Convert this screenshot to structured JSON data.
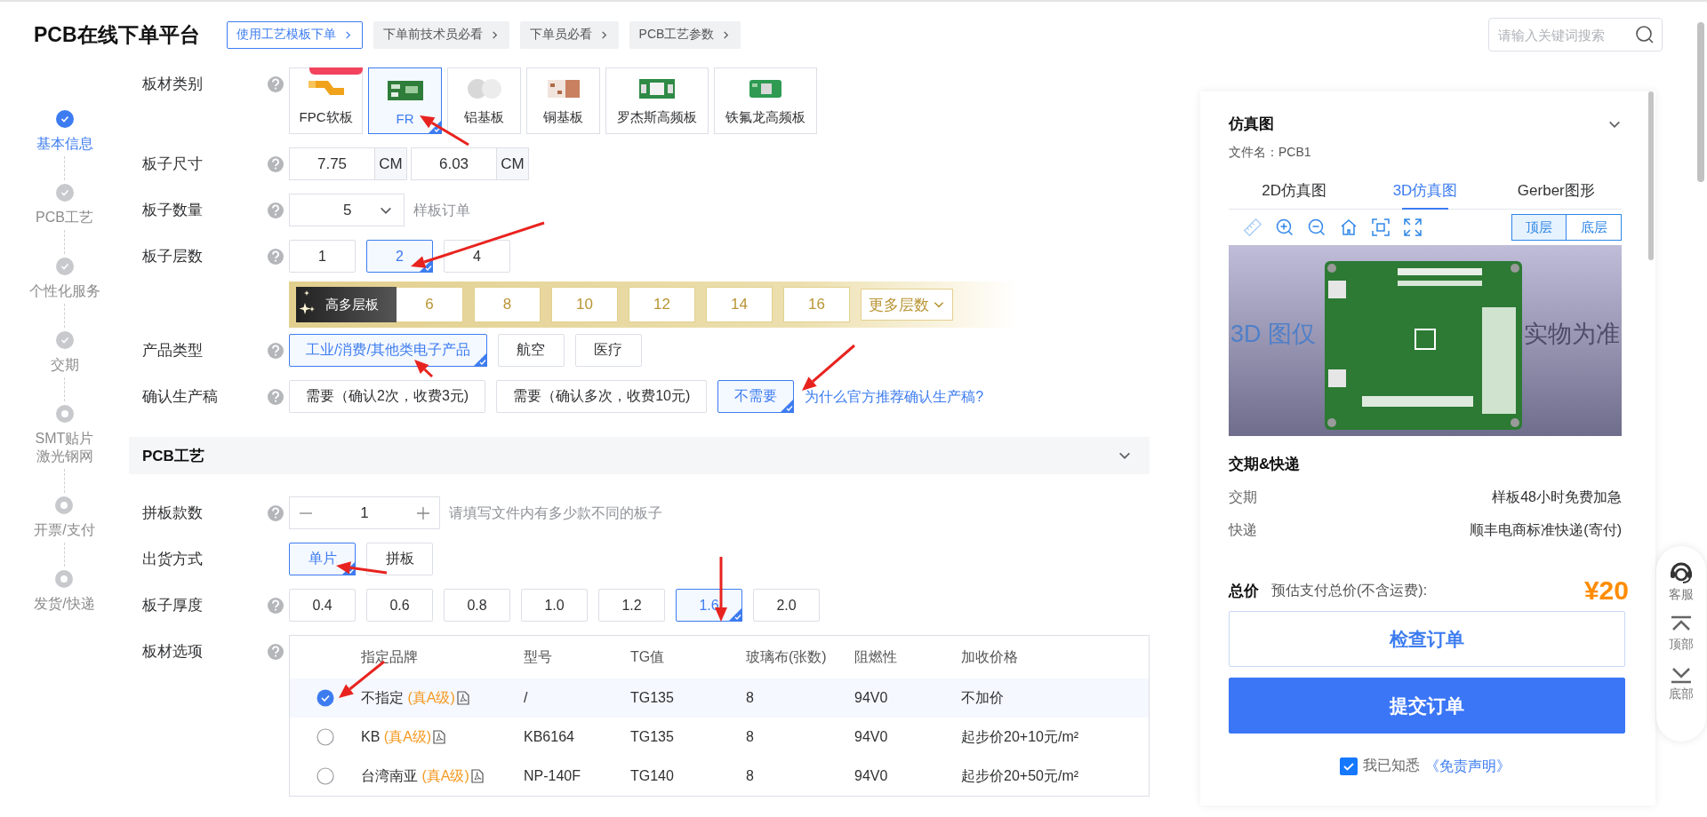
{
  "header": {
    "title": "PCB在线下单平台",
    "links": [
      {
        "label": "使用工艺模板下单",
        "kind": "primary"
      },
      {
        "label": "下单前技术员必看",
        "kind": "plain"
      },
      {
        "label": "下单员必看",
        "kind": "plain"
      },
      {
        "label": "PCB工艺参数",
        "kind": "plain"
      }
    ],
    "search": {
      "placeholder": "请输入关键词搜索"
    }
  },
  "steps": [
    {
      "label": "基本信息",
      "selected": true,
      "done": true
    },
    {
      "label": "PCB工艺",
      "selected": false,
      "done": true
    },
    {
      "label": "个性化服务",
      "selected": false,
      "done": true
    },
    {
      "label": "交期",
      "selected": false,
      "done": true
    },
    {
      "label": "SMT贴片激光钢网",
      "selected": false,
      "done": false
    },
    {
      "label": "开票/支付",
      "selected": false,
      "done": false
    },
    {
      "label": "发货/快递",
      "selected": false,
      "done": false
    }
  ],
  "sections": [
    {
      "rows": [
        {
          "kind": "cards",
          "label": "板材类别",
          "help": true,
          "options": [
            {
              "label": "FPC软板",
              "selected": false,
              "badge": true
            },
            {
              "label": "FR",
              "selected": true,
              "badge": false
            },
            {
              "label": "铝基板",
              "selected": false,
              "badge": false
            },
            {
              "label": "铜基板",
              "selected": false,
              "badge": false
            },
            {
              "label": "罗杰斯高频板",
              "selected": false,
              "badge": false
            },
            {
              "label": "铁氟龙高频板",
              "selected": false,
              "badge": false
            }
          ]
        },
        {
          "kind": "size",
          "label": "板子尺寸",
          "help": true,
          "fields": [
            {
              "value": "7.75",
              "unit": "CM"
            },
            {
              "value": "6.03",
              "unit": "CM"
            }
          ]
        },
        {
          "kind": "select",
          "label": "板子数量",
          "help": true,
          "value": "5",
          "note": "样板订单"
        },
        {
          "kind": "options",
          "label": "板子层数",
          "help": true,
          "options": [
            {
              "label": "1",
              "selected": false
            },
            {
              "label": "2",
              "selected": true
            },
            {
              "label": "4",
              "selected": false
            }
          ]
        },
        {
          "kind": "band",
          "badge": "高多层板",
          "options": [
            {
              "label": "6",
              "selected": false
            },
            {
              "label": "8",
              "selected": false
            },
            {
              "label": "10",
              "selected": false
            },
            {
              "label": "12",
              "selected": false
            },
            {
              "label": "14",
              "selected": false
            },
            {
              "label": "16",
              "selected": false
            }
          ],
          "more": "更多层数"
        },
        {
          "kind": "options",
          "label": "产品类型",
          "help": true,
          "options": [
            {
              "label": "工业/消费/其他类电子产品",
              "selected": true
            },
            {
              "label": "航空",
              "selected": false
            },
            {
              "label": "医疗",
              "selected": false
            }
          ]
        },
        {
          "kind": "options",
          "label": "确认生产稿",
          "help": true,
          "options": [
            {
              "label": "需要（确认2次，收费3元)",
              "selected": false
            },
            {
              "label": "需要（确认多次，收费10元)",
              "selected": false
            },
            {
              "label": "不需要",
              "selected": true
            }
          ],
          "link": "为什么官方推荐确认生产稿?"
        }
      ]
    },
    {
      "title": "PCB工艺",
      "expanded": true,
      "rows": [
        {
          "kind": "stepper",
          "label": "拼板款数",
          "help": true,
          "value": "1",
          "note": "请填写文件内有多少款不同的板子"
        },
        {
          "kind": "options",
          "label": "出货方式",
          "help": false,
          "options": [
            {
              "label": "单片",
              "selected": true
            },
            {
              "label": "拼板",
              "selected": false
            }
          ]
        },
        {
          "kind": "options",
          "label": "板子厚度",
          "help": true,
          "options": [
            {
              "label": "0.4",
              "selected": false
            },
            {
              "label": "0.6",
              "selected": false
            },
            {
              "label": "0.8",
              "selected": false
            },
            {
              "label": "1.0",
              "selected": false
            },
            {
              "label": "1.2",
              "selected": false
            },
            {
              "label": "1.6",
              "selected": true
            },
            {
              "label": "2.0",
              "selected": false
            }
          ]
        },
        {
          "kind": "table",
          "label": "板材选项",
          "help": true,
          "columns": [
            "指定品牌",
            "型号",
            "TG值",
            "玻璃布(张数)",
            "阻燃性",
            "加收价格"
          ],
          "rows": [
            {
              "selected": true,
              "brand": "不指定",
              "grade": "(真A级)",
              "model": "/",
              "tg": "TG135",
              "cloth": "8",
              "flame": "94V0",
              "price": "不加价"
            },
            {
              "selected": false,
              "brand": "KB",
              "grade": "(真A级)",
              "model": "KB6164",
              "tg": "TG135",
              "cloth": "8",
              "flame": "94V0",
              "price": "起步价20+10元/m²"
            },
            {
              "selected": false,
              "brand": "台湾南亚",
              "grade": "(真A级)",
              "model": "NP-140F",
              "tg": "TG140",
              "cloth": "8",
              "flame": "94V0",
              "price": "起步价20+50元/m²"
            }
          ]
        }
      ]
    }
  ],
  "preview": {
    "title": "仿真图",
    "expanded": true,
    "file": "文件名：PCB1",
    "tabs": [
      {
        "label": "2D仿真图",
        "selected": false
      },
      {
        "label": "3D仿真图",
        "selected": true
      },
      {
        "label": "Gerber图形",
        "selected": false
      }
    ],
    "layers": [
      {
        "label": "顶层",
        "selected": true
      },
      {
        "label": "底层",
        "selected": false
      }
    ],
    "notice": [
      "3D 图仅",
      "实物为准"
    ]
  },
  "delivery": {
    "title": "交期&快递",
    "items": [
      {
        "label": "交期",
        "value": "样板48小时免费加急"
      },
      {
        "label": "快递",
        "value": "顺丰电商标准快递(寄付)"
      }
    ]
  },
  "total": {
    "label": "总价",
    "note": "预估支付总价(不含运费):",
    "price": "¥20"
  },
  "buttons": [
    {
      "label": "检查订单",
      "kind": "outline"
    },
    {
      "label": "提交订单",
      "kind": "primary"
    }
  ],
  "agree": {
    "checked": true,
    "text": "我已知悉",
    "link": "《免责声明》"
  },
  "tools": [
    {
      "label": "客服"
    },
    {
      "label": "顶部"
    },
    {
      "label": "底部"
    }
  ]
}
